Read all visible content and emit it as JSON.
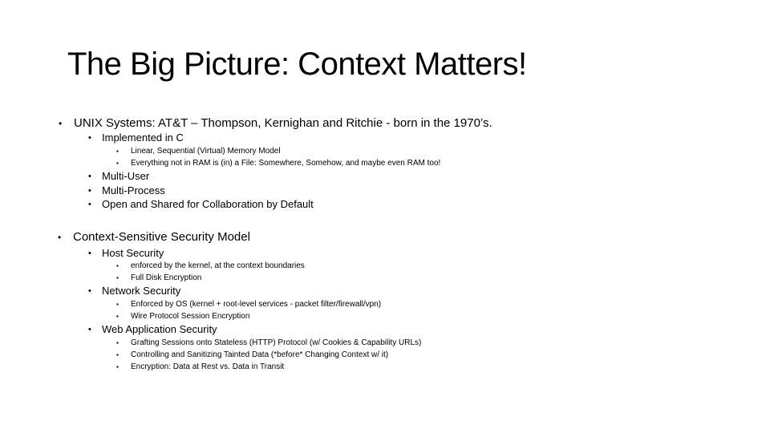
{
  "slide": {
    "title": "The Big Picture:  Context Matters!",
    "bullets": {
      "unix": {
        "text": "UNIX Systems: AT&T – Thompson, Kernighan and Ritchie - born in the 1970’s.",
        "implemented": {
          "text": "Implemented in C",
          "items": [
            "Linear, Sequential (Virtual) Memory Model",
            "Everything not in RAM is (in) a File: Somewhere, Somehow, and maybe even RAM too!"
          ]
        },
        "others": [
          "Multi-User",
          "Multi-Process",
          "Open and Shared for Collaboration by Default"
        ]
      },
      "security": {
        "text": "Context-Sensitive Security Model",
        "host": {
          "text": "Host Security",
          "items": [
            " enforced by the kernel, at the context boundaries",
            "Full Disk Encryption"
          ]
        },
        "network": {
          "text": "Network Security",
          "items": [
            "Enforced by OS (kernel + root-level services - packet filter/firewall/vpn)",
            "Wire Protocol Session Encryption"
          ]
        },
        "web": {
          "text": "Web Application Security",
          "items": [
            "Grafting Sessions onto Stateless (HTTP) Protocol (w/ Cookies & Capability URLs)",
            "Controlling and Sanitizing Tainted Data (*before* Changing Context w/ it)",
            "Encryption: Data at Rest vs. Data in Transit"
          ]
        }
      }
    },
    "bullet_glyphs": {
      "level1": "•",
      "level2": "•",
      "level3": "▪"
    }
  }
}
